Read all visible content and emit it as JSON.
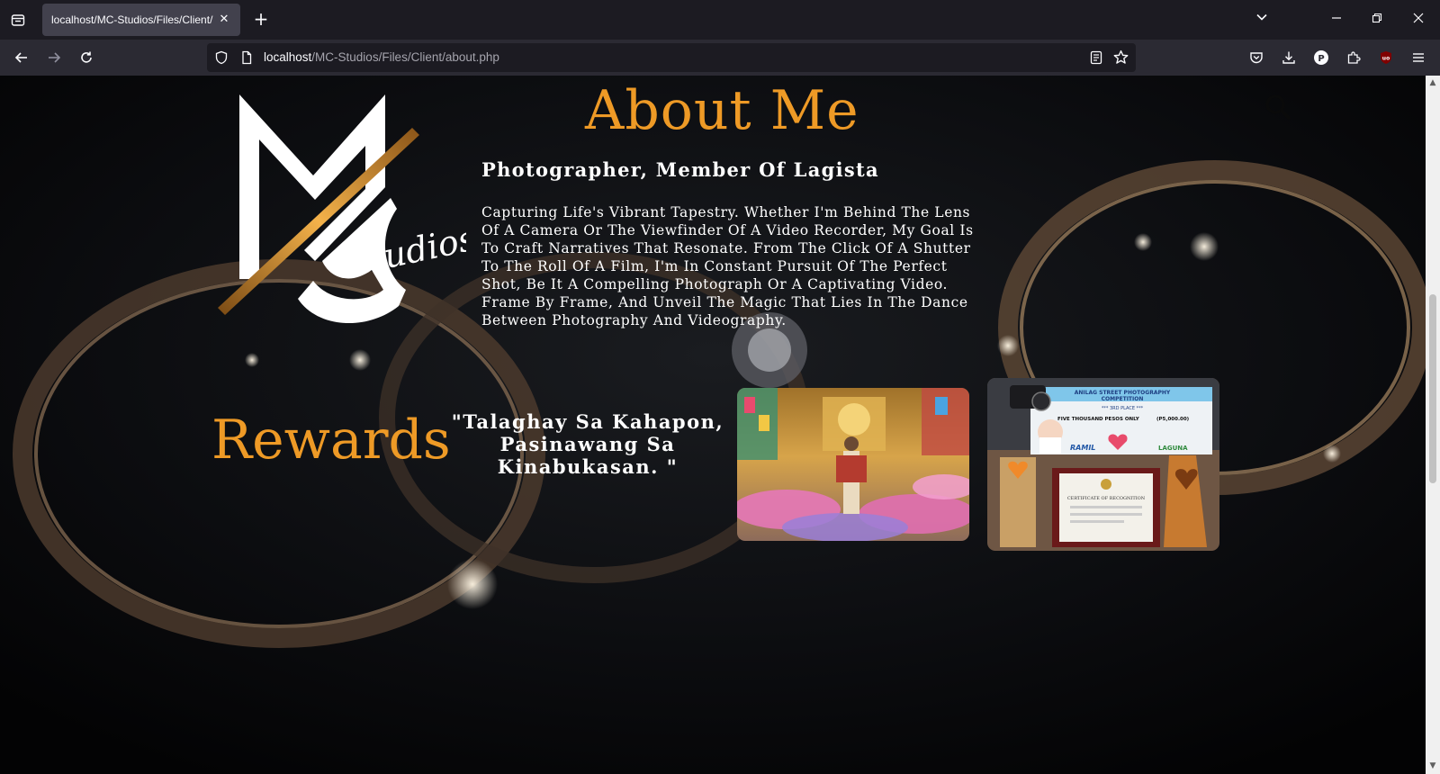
{
  "browser": {
    "tab_title": "localhost/MC-Studios/Files/Client/",
    "url_host": "localhost",
    "url_path": "/MC-Studios/Files/Client/about.php"
  },
  "logo": {
    "script_text": "Studios"
  },
  "about": {
    "title": "About Me",
    "subtitle": "Photographer, Member Of Lagista",
    "body": "Capturing Life's Vibrant Tapestry. Whether I'm Behind The Lens Of A Camera Or The Viewfinder Of A Video Recorder, My Goal Is To Craft Narratives That Resonate. From The Click Of A Shutter To The Roll Of A Film, I'm In Constant Pursuit Of The Perfect Shot, Be It A Compelling Photograph Or A Captivating Video. Frame By Frame, And Unveil The Magic That Lies In The Dance Between Photography And Videography."
  },
  "rewards": {
    "title": "Rewards",
    "quote": "\"Talaghay Sa Kahapon, Pasinawang Sa Kinabukasan. \""
  },
  "award_photo": {
    "header_line1": "ANILAG STREET PHOTOGRAPHY",
    "header_line2": "COMPETITION",
    "place": "*** 3RD PLACE ***",
    "prize": "FIVE THOUSAND PESOS ONLY",
    "amount": "(P5,000.00)",
    "sponsor": "RAMIL",
    "certificate": "CERTIFICATE OF RECOGNITION",
    "brand": "LAGUNA"
  },
  "icons": {
    "tab_list": "tab-list-icon",
    "search": "search-icon"
  },
  "colors": {
    "accent": "#ee9a26",
    "text": "#ffffff",
    "chrome_dark": "#1c1b22",
    "chrome_mid": "#2b2a33"
  }
}
